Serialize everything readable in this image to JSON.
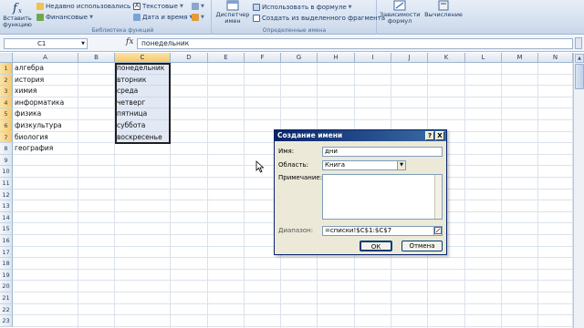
{
  "ribbon": {
    "insert_function": {
      "label_line1": "Вставить",
      "label_line2": "функцию"
    },
    "library": {
      "recently_used": "Недавно использовались",
      "text": "Текстовые",
      "financial": "Финансовые",
      "date_time": "Дата и время",
      "caption": "Библиотека функций"
    },
    "names": {
      "manager_line1": "Диспетчер",
      "manager_line2": "имен",
      "use_in_formula": "Использовать в формуле",
      "create_from_selection": "Создать из выделенного фрагмента",
      "caption": "Определенные имена"
    },
    "dependencies": {
      "label_line1": "Зависимости",
      "label_line2": "формул"
    },
    "calculation": {
      "label": "Вычисление"
    }
  },
  "formula_bar": {
    "name_box": "C1",
    "fx": "fx",
    "formula": "понедельник"
  },
  "grid": {
    "columns": [
      "A",
      "B",
      "C",
      "D",
      "E",
      "F",
      "G",
      "H",
      "I",
      "J",
      "K",
      "L",
      "M",
      "N"
    ],
    "rows": [
      "1",
      "2",
      "3",
      "4",
      "5",
      "6",
      "7",
      "8",
      "9",
      "10",
      "11",
      "12",
      "13",
      "14",
      "15",
      "16",
      "17",
      "18",
      "19",
      "20",
      "21",
      "22",
      "23"
    ],
    "col_a": [
      "алгебра",
      "история",
      "химия",
      "информатика",
      "физика",
      "физкультура",
      "биология",
      "география"
    ],
    "col_c": [
      "понедельник",
      "вторник",
      "среда",
      "четверг",
      "пятница",
      "суббота",
      "воскресенье"
    ]
  },
  "dialog": {
    "title": "Создание имени",
    "help": "?",
    "close": "X",
    "name_label": "Имя:",
    "name_value": "дни",
    "scope_label": "Область:",
    "scope_value": "Книга",
    "comment_label": "Примечание:",
    "comment_value": "",
    "range_label": "Диапазон:",
    "range_value": "=списки!$C$1:$C$7",
    "ok": "ОК",
    "cancel": "Отмена"
  },
  "colors": {
    "ribbon_bg": "#d3dfee",
    "selection_header": "#f6c86a",
    "dialog_title": "#0a246a",
    "dialog_bg": "#ece9d8"
  }
}
